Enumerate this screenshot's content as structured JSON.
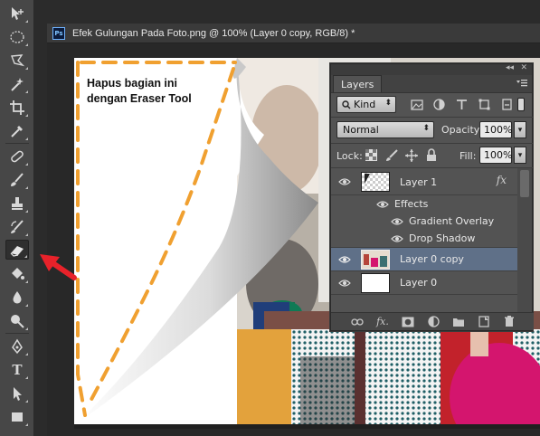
{
  "document": {
    "badge": "Ps",
    "title": "Efek Gulungan Pada Foto.png @ 100% (Layer 0 copy, RGB/8) *"
  },
  "canvas": {
    "caption_line1": "Hapus bagian ini",
    "caption_line2": "dengan Eraser Tool"
  },
  "layers_panel": {
    "tab": "Layers",
    "collapse_glyph": "◂◂",
    "close_glyph": "✕",
    "kind_label": "Kind",
    "blend_mode": "Normal",
    "opacity_label": "Opacity:",
    "opacity_value": "100%",
    "lock_label": "Lock:",
    "fill_label": "Fill:",
    "fill_value": "100%",
    "layers": [
      {
        "name": "Layer 1",
        "fx": "fx"
      },
      {
        "name": "Effects"
      },
      {
        "name": "Gradient Overlay"
      },
      {
        "name": "Drop Shadow"
      },
      {
        "name": "Layer 0 copy",
        "selected": true
      },
      {
        "name": "Layer 0"
      }
    ],
    "bottom_fx": "fx."
  },
  "tools": {
    "type_glyph": "T",
    "active_tool": "eraser-tool"
  },
  "colors": {
    "accent_selected": "#5f7088",
    "arrow": "#e8222a",
    "dash_orange": "#f0a030"
  }
}
